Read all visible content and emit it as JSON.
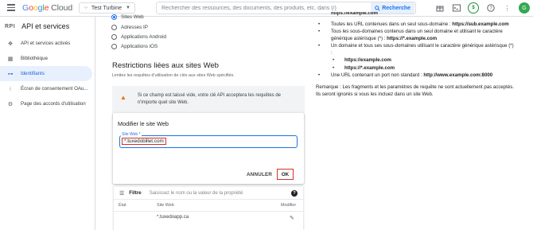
{
  "topbar": {
    "logo_text": "Google Cloud",
    "project_name": "Test Turbine",
    "search_placeholder": "Rechercher des ressources, des documents, des produits, etc. dans (/)",
    "search_button_label": "Recherche",
    "avatar_letter": "G",
    "status_letter": "$"
  },
  "sidebar": {
    "title": "API et services",
    "items": [
      {
        "label": "API et services activés",
        "icon": "api-icon"
      },
      {
        "label": "Bibliothèque",
        "icon": "library-icon"
      },
      {
        "label": "Identifiants",
        "icon": "key-icon"
      },
      {
        "label": "Écran de consentement OAu...",
        "icon": "consent-icon"
      },
      {
        "label": "Page des accords d'utilisation",
        "icon": "agreements-icon"
      }
    ],
    "active_index": 2
  },
  "main": {
    "radios": [
      {
        "label": "Sites Web",
        "checked": true
      },
      {
        "label": "Adresses IP",
        "checked": false
      },
      {
        "label": "Applications Android",
        "checked": false
      },
      {
        "label": "Applications iOS",
        "checked": false
      }
    ],
    "section_title": "Restrictions liées aux sites Web",
    "section_subtitle": "Limitez les requêtes d'utilisation de clés aux sites Web spécifiés.",
    "warning_line1": "Si ce champ est laissé vide, votre clé API acceptera les requêtes de",
    "warning_line2": "n'importe quel site Web.",
    "edit_card": {
      "title": "Modifier le site Web",
      "field_label": "Site Web *",
      "field_value": "*.tuxedobillet.com",
      "cancel_label": "ANNULER",
      "ok_label": "OK"
    },
    "table": {
      "filter_label": "Filtre",
      "filter_placeholder": "Saisissez le nom ou la valeur de la propriété",
      "columns": [
        "État",
        "Site Web",
        "Modifier"
      ],
      "rows": [
        {
          "status": "",
          "site": "*.tuxedoapp.ca"
        }
      ]
    }
  },
  "help_panel": {
    "clipped_top": "https://example.com",
    "items": [
      {
        "text": "Toutes les URL contenues dans un seul sous-domaine :",
        "bold": "https://sub.example.com",
        "level": 0
      },
      {
        "text": "Tous les sous-domaines contenus dans un seul domaine et utilisant le caractère générique astérisque (*) : ",
        "bold": "https://*.example.com",
        "level": 0
      },
      {
        "text": "Un domaine et tous ses sous-domaines utilisant le caractère générique astérisque (*) :",
        "bold": "",
        "level": 0
      },
      {
        "text": "",
        "bold": "https://example.com",
        "level": 1
      },
      {
        "text": "",
        "bold": "https://*.example.com",
        "level": 1
      },
      {
        "text": "Une URL contenant un port non standard : ",
        "bold": "http://www.example.com:8000",
        "level": 0
      }
    ],
    "remark": "Remarque : Les fragments et les paramètres de requête ne sont actuellement pas acceptés. Ils seront ignorés si vous les incluez dans un site Web."
  },
  "colors": {
    "accent": "#1a73e8",
    "highlight_red": "#d93025",
    "warning": "#e37400"
  }
}
